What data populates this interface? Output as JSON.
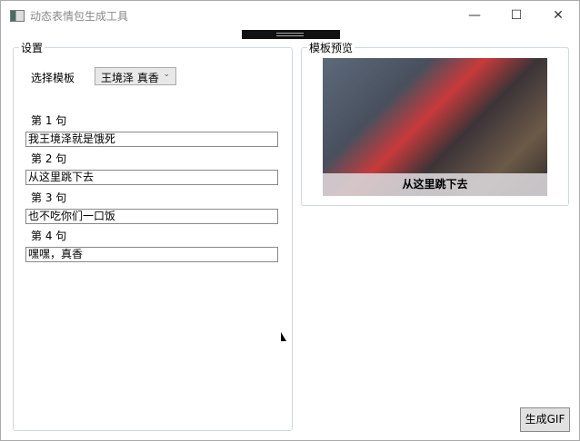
{
  "window": {
    "title": "动态表情包生成工具",
    "minimize": "—",
    "maximize": "☐",
    "close": "✕"
  },
  "settings": {
    "group_label": "设置",
    "template_label": "选择模板",
    "template_value": "王境泽 真香",
    "sentences": [
      {
        "label": "第 1 句",
        "value": "我王境泽就是饿死"
      },
      {
        "label": "第 2 句",
        "value": "从这里跳下去"
      },
      {
        "label": "第 3 句",
        "value": "也不吃你们一口饭"
      },
      {
        "label": "第 4 句",
        "value": "嘿嘿，真香"
      }
    ]
  },
  "preview": {
    "group_label": "模板预览",
    "caption": "从这里跳下去"
  },
  "generate_button": "生成GIF"
}
